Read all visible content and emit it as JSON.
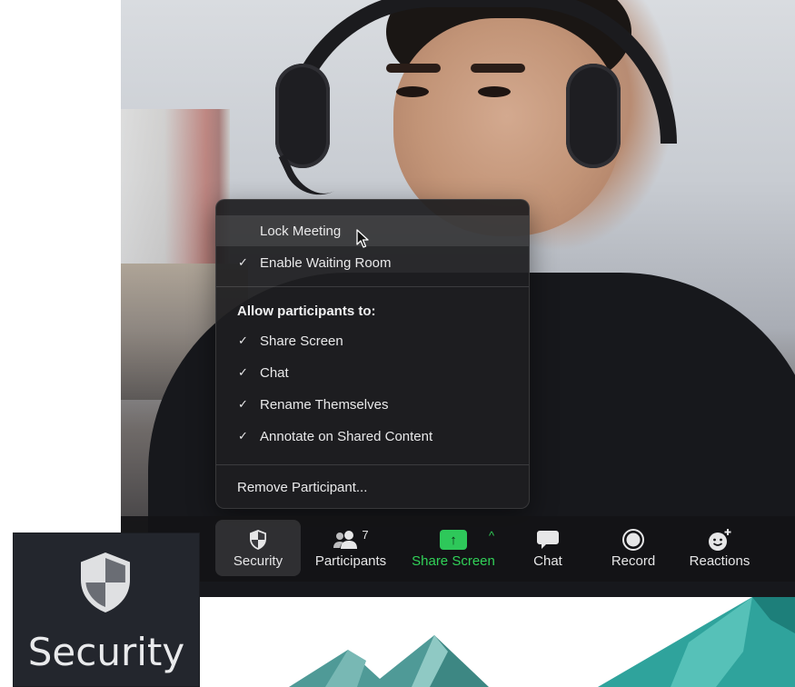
{
  "menu": {
    "lock_meeting": "Lock Meeting",
    "enable_waiting_room": "Enable Waiting Room",
    "allow_header": "Allow participants to:",
    "share_screen": "Share Screen",
    "chat": "Chat",
    "rename": "Rename Themselves",
    "annotate": "Annotate on Shared Content",
    "remove": "Remove Participant...",
    "check": "✓"
  },
  "toolbar": {
    "security": "Security",
    "participants": "Participants",
    "participants_count": "7",
    "share_screen": "Share Screen",
    "chat": "Chat",
    "record": "Record",
    "reactions": "Reactions",
    "share_arrow": "↑",
    "share_caret": "^"
  },
  "inset": {
    "label": "Security"
  },
  "colors": {
    "share_green": "#31d158",
    "menu_bg": "#1e1e20",
    "toolbar_bg": "#141416",
    "mountain_teal": "#3fb5ad"
  }
}
